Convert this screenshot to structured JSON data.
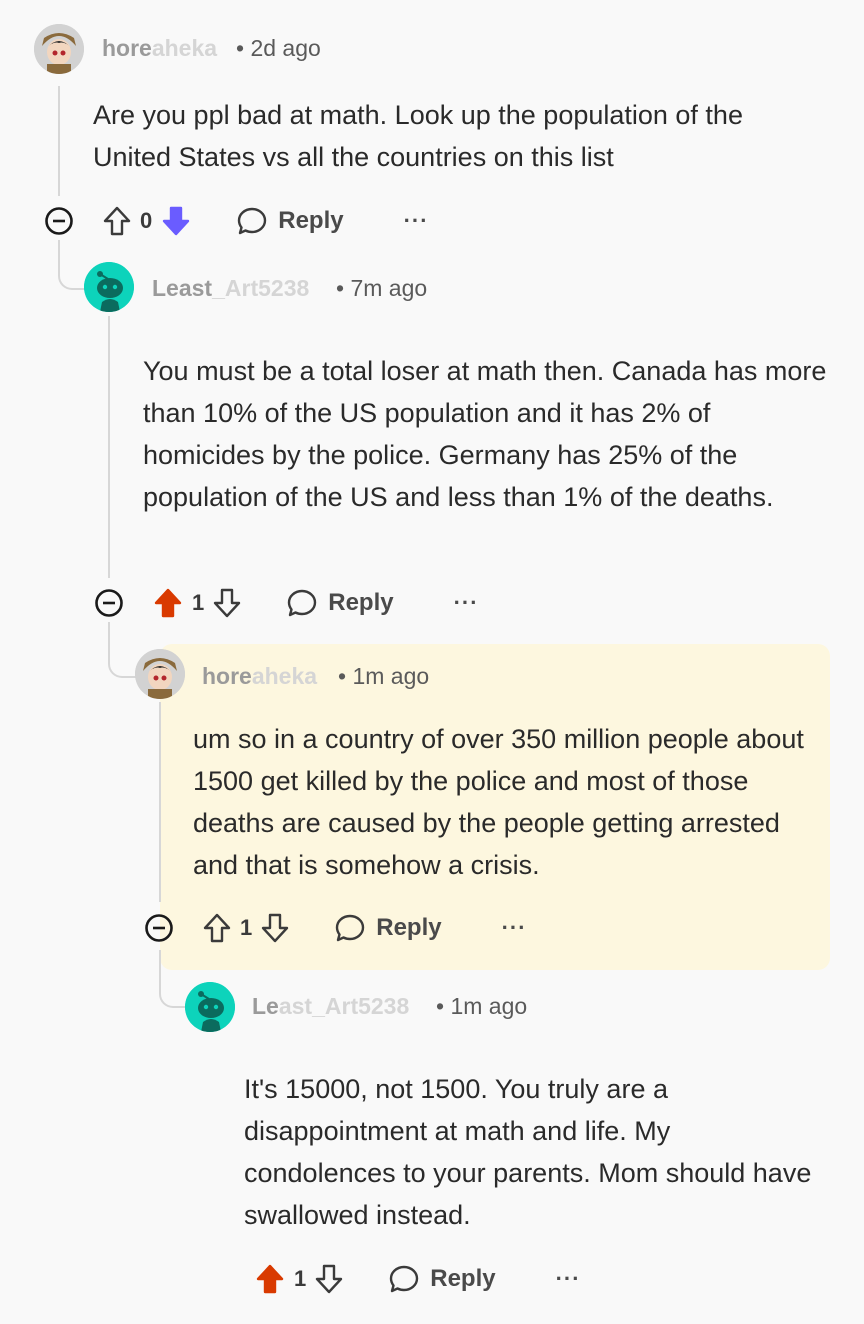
{
  "comments": [
    {
      "user_visible": "hore",
      "user_blurred": "aheka",
      "time": "• 2d ago",
      "body": "Are you ppl bad at math. Look up the population of the United States vs all the countries on this list",
      "votes": "0",
      "vote_state": "downvoted",
      "reply_label": "Reply",
      "more": "···"
    },
    {
      "user_visible": "Least",
      "user_blurred": "_Art5238",
      "time": "• 7m ago",
      "body": "You must be a total loser at math then. Canada has more than 10% of the US population and it has 2% of homicides by the police. Germany has 25% of the population of the US and less than 1% of the deaths.",
      "votes": "1",
      "vote_state": "upvoted",
      "reply_label": "Reply",
      "more": "···"
    },
    {
      "user_visible": "hore",
      "user_blurred": "aheka",
      "time": "• 1m ago",
      "body": "um so in a country of over 350 million people about 1500 get killed by the police and most of those deaths are caused by the people getting arrested and that is somehow a crisis.",
      "votes": "1",
      "vote_state": "none",
      "reply_label": "Reply",
      "more": "···"
    },
    {
      "user_visible": "Le",
      "user_blurred": "ast_Art5238",
      "time": "• 1m ago",
      "body": "It's 15000, not 1500. You truly are a disappointment at math and life. My condolences to your parents. Mom should have swallowed instead.",
      "votes": "1",
      "vote_state": "upvoted",
      "reply_label": "Reply",
      "more": "···"
    }
  ],
  "colors": {
    "upvote": "#d93a00",
    "downvote": "#6a5cff",
    "highlight_bg": "#fdf7df",
    "snoo_avatar": "#0dd3bb",
    "thread_line": "#d7d7d7"
  },
  "icons": [
    "collapse-icon",
    "upvote-icon",
    "downvote-icon",
    "reply-bubble-icon",
    "more-dots-icon",
    "snoo-avatar",
    "anime-avatar"
  ]
}
